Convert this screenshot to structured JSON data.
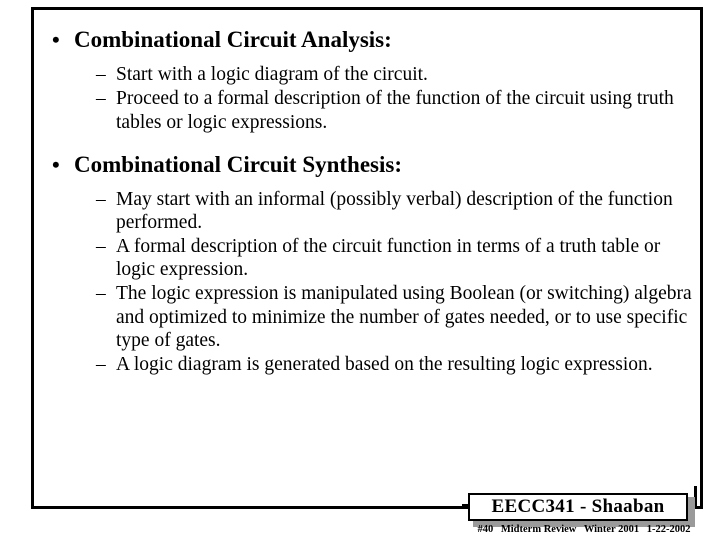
{
  "slide": {
    "background_color": "#ffffff",
    "frame_color": "#000000",
    "blocks": [
      {
        "level": 1,
        "marker": "•",
        "text": "Combinational Circuit Analysis:"
      },
      {
        "level": 2,
        "marker": "–",
        "text": "Start with a logic diagram of the circuit."
      },
      {
        "level": 2,
        "marker": "–",
        "text": "Proceed to a formal description of the function of the circuit using truth tables or logic expressions."
      },
      {
        "level": 1,
        "marker": "•",
        "text": "Combinational Circuit Synthesis:"
      },
      {
        "level": 2,
        "marker": "–",
        "text": "May start with an informal (possibly verbal) description of the function performed."
      },
      {
        "level": 2,
        "marker": "–",
        "text": "A formal description of the circuit function in terms of a truth table or logic expression."
      },
      {
        "level": 2,
        "marker": "–",
        "text": "The logic expression is manipulated using Boolean (or switching) algebra and optimized to minimize  the number of gates needed, or to use specific type of gates."
      },
      {
        "level": 2,
        "marker": "–",
        "text": "A logic diagram is generated based on the resulting logic expression."
      }
    ]
  },
  "footer": {
    "course_label": "EECC341 - Shaaban",
    "slide_number": "#40",
    "topic": "Midterm Review",
    "term": "Winter 2001",
    "date": "1-22-2002",
    "shadow_color": "#9a9a9a",
    "border_color": "#000000"
  }
}
